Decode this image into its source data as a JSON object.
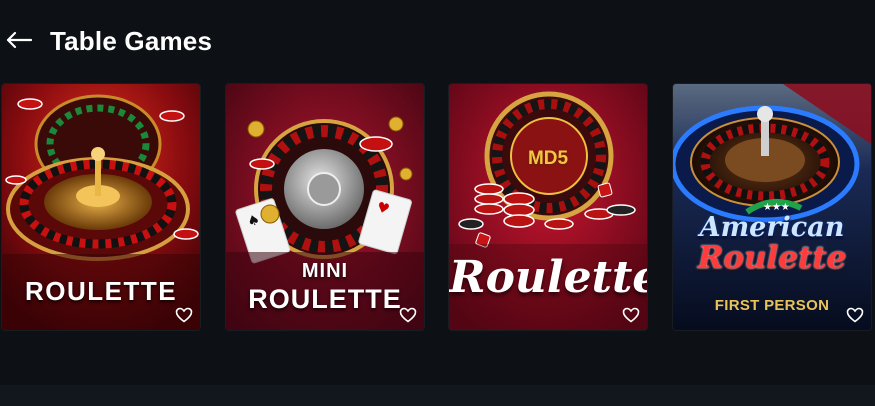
{
  "header": {
    "back_icon": "arrow-left-icon",
    "title": "Table Games"
  },
  "games": [
    {
      "title": "ROULETTE",
      "favorite_icon": "heart-outline-icon"
    },
    {
      "title_line1": "MINI",
      "title_line2": "ROULETTE",
      "favorite_icon": "heart-outline-icon"
    },
    {
      "badge": "MD5",
      "title": "Roulette",
      "favorite_icon": "heart-outline-icon"
    },
    {
      "title_line1": "American",
      "title_line2": "Roulette",
      "subtitle": "FIRST PERSON",
      "favorite_icon": "heart-outline-icon"
    }
  ],
  "colors": {
    "background": "#0d1015",
    "card_red": "#8b0d17",
    "card_crimson": "#6a0c1c",
    "card_blue": "#0b1838"
  }
}
